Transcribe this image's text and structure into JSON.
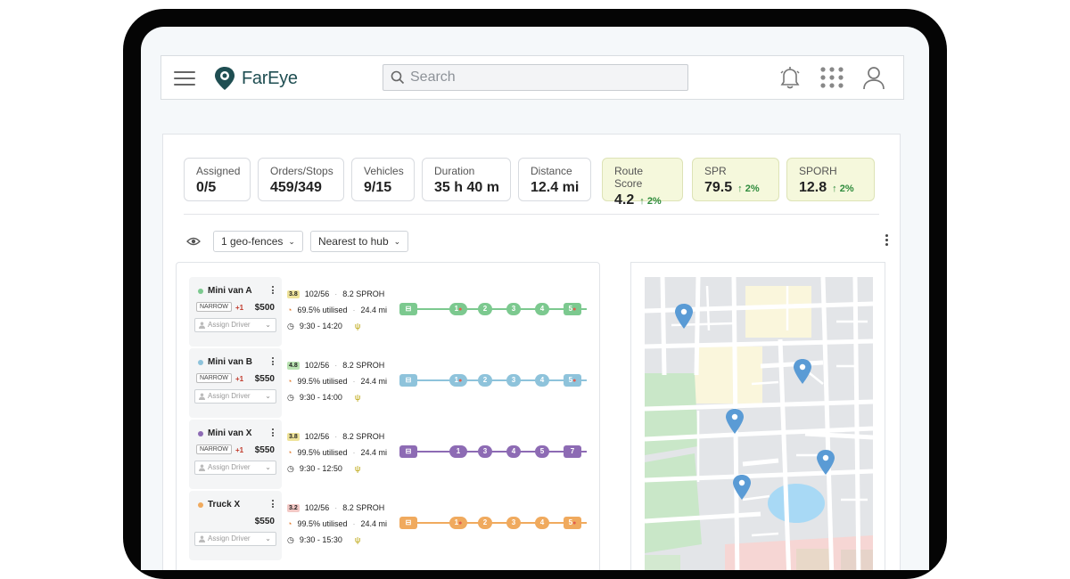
{
  "app": {
    "brand": "FarEye"
  },
  "search": {
    "placeholder": "Search"
  },
  "stats": [
    {
      "label": "Assigned",
      "value": "0/5"
    },
    {
      "label": "Orders/Stops",
      "value": "459/349"
    },
    {
      "label": "Vehicles",
      "value": "9/15"
    },
    {
      "label": "Duration",
      "value": "35 h 40 m"
    },
    {
      "label": "Distance",
      "value": "12.4 mi"
    }
  ],
  "highlight_stats": [
    {
      "label": "Route Score",
      "value": "4.2",
      "delta": "2%"
    },
    {
      "label": "SPR",
      "value": "79.5",
      "delta": "2%"
    },
    {
      "label": "SPORH",
      "value": "12.8",
      "delta": "2%"
    }
  ],
  "toolbar": {
    "geofence": "1 geo-fences",
    "sort": "Nearest to hub"
  },
  "routes": [
    {
      "name": "Mini van A",
      "color": "#7cc98f",
      "tag": "NARROW",
      "plus": "+1",
      "price": "$500",
      "assign": "Assign Driver",
      "score": "3.8",
      "score_bg": "#efe39a",
      "orders": "102/56",
      "sproh": "8.2 SPROH",
      "util": "69.5% utilised",
      "dist": "24.4 mi",
      "time": "9:30 - 14:20",
      "stops": [
        "1",
        "2",
        "3",
        "4",
        "5"
      ]
    },
    {
      "name": "Mini van B",
      "color": "#8ec3db",
      "tag": "NARROW",
      "plus": "+1",
      "price": "$550",
      "assign": "Assign Driver",
      "score": "4.8",
      "score_bg": "#b9e3b2",
      "orders": "102/56",
      "sproh": "8.2 SPROH",
      "util": "99.5% utilised",
      "dist": "24.4 mi",
      "time": "9:30 - 14:00",
      "stops": [
        "1",
        "2",
        "3",
        "4",
        "5"
      ]
    },
    {
      "name": "Mini van X",
      "color": "#8d6bb4",
      "tag": "NARROW",
      "plus": "+1",
      "price": "$550",
      "assign": "Assign Driver",
      "score": "3.8",
      "score_bg": "#efe39a",
      "orders": "102/56",
      "sproh": "8.2 SPROH",
      "util": "99.5% utilised",
      "dist": "24.4 mi",
      "time": "9:30 - 12:50",
      "stops": [
        "1",
        "3",
        "4",
        "5",
        "7"
      ]
    },
    {
      "name": "Truck X",
      "color": "#f0aa5e",
      "tag": "",
      "plus": "",
      "price": "$550",
      "assign": "Assign Driver",
      "score": "3.2",
      "score_bg": "#f3c9c6",
      "orders": "102/56",
      "sproh": "8.2 SPROH",
      "util": "99.5% utilised",
      "dist": "24.4 mi",
      "time": "9:30 - 15:30",
      "stops": [
        "1",
        "2",
        "3",
        "4",
        "5"
      ]
    }
  ]
}
